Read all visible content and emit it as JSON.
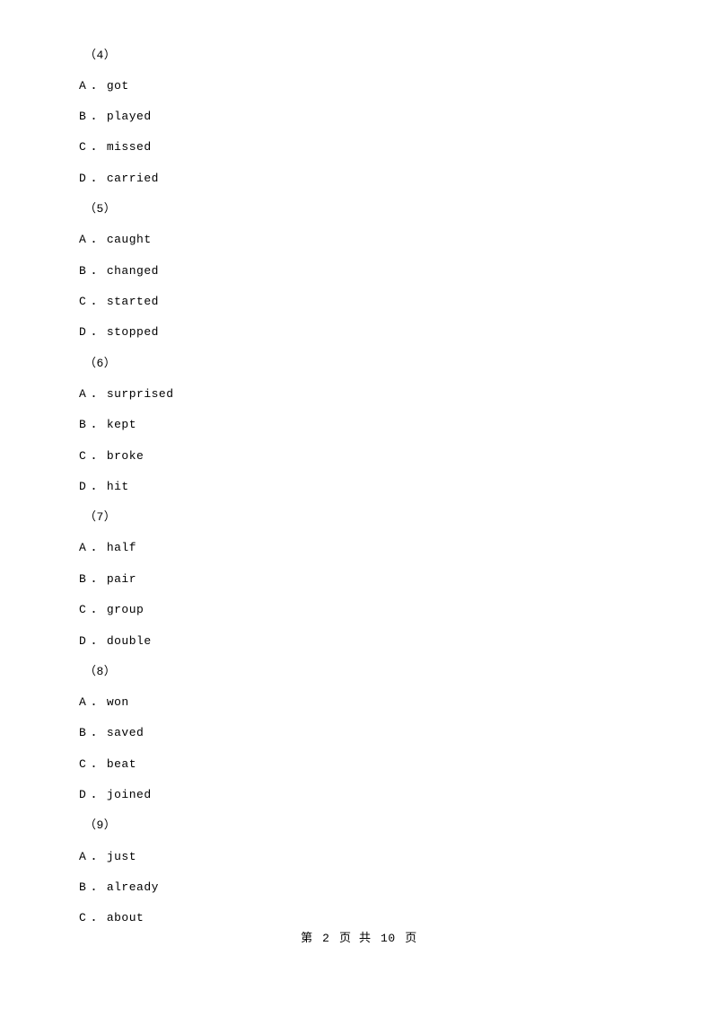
{
  "document": {
    "blocks": [
      {
        "number": "（4）",
        "options": [
          {
            "letter": "A",
            "dot": "．",
            "text": "got"
          },
          {
            "letter": "B",
            "dot": "．",
            "text": "played"
          },
          {
            "letter": "C",
            "dot": "．",
            "text": "missed"
          },
          {
            "letter": "D",
            "dot": "．",
            "text": "carried"
          }
        ]
      },
      {
        "number": "（5）",
        "options": [
          {
            "letter": "A",
            "dot": "．",
            "text": "caught"
          },
          {
            "letter": "B",
            "dot": "．",
            "text": "changed"
          },
          {
            "letter": "C",
            "dot": "．",
            "text": "started"
          },
          {
            "letter": "D",
            "dot": "．",
            "text": "stopped"
          }
        ]
      },
      {
        "number": "（6）",
        "options": [
          {
            "letter": "A",
            "dot": "．",
            "text": "surprised"
          },
          {
            "letter": "B",
            "dot": "．",
            "text": "kept"
          },
          {
            "letter": "C",
            "dot": "．",
            "text": "broke"
          },
          {
            "letter": "D",
            "dot": "．",
            "text": "hit"
          }
        ]
      },
      {
        "number": "（7）",
        "options": [
          {
            "letter": "A",
            "dot": "．",
            "text": "half"
          },
          {
            "letter": "B",
            "dot": "．",
            "text": "pair"
          },
          {
            "letter": "C",
            "dot": "．",
            "text": "group"
          },
          {
            "letter": "D",
            "dot": "．",
            "text": "double"
          }
        ]
      },
      {
        "number": "（8）",
        "options": [
          {
            "letter": "A",
            "dot": "．",
            "text": "won"
          },
          {
            "letter": "B",
            "dot": "．",
            "text": "saved"
          },
          {
            "letter": "C",
            "dot": "．",
            "text": "beat"
          },
          {
            "letter": "D",
            "dot": "．",
            "text": "joined"
          }
        ]
      },
      {
        "number": "（9）",
        "options": [
          {
            "letter": "A",
            "dot": "．",
            "text": "just"
          },
          {
            "letter": "B",
            "dot": "．",
            "text": "already"
          },
          {
            "letter": "C",
            "dot": "．",
            "text": "about"
          }
        ]
      }
    ]
  },
  "footer": {
    "prefix": "第",
    "page_number": "2",
    "middle": "页 共",
    "total_pages": "10",
    "suffix": "页"
  }
}
